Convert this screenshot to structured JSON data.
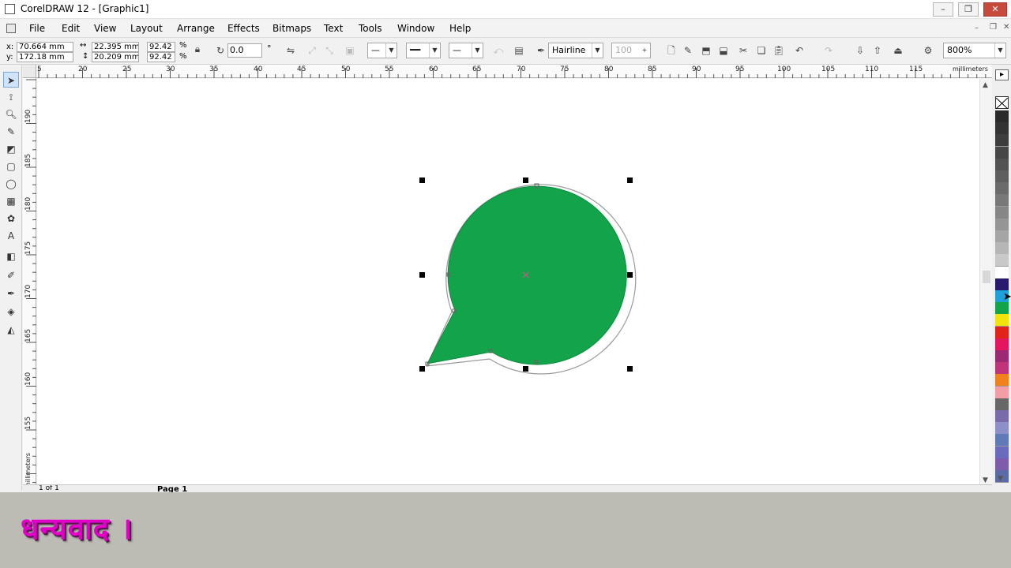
{
  "window": {
    "title": "CorelDRAW 12 - [Graphic1]",
    "controls": [
      "minimize",
      "restore",
      "close"
    ]
  },
  "menu": [
    "File",
    "Edit",
    "View",
    "Layout",
    "Arrange",
    "Effects",
    "Bitmaps",
    "Text",
    "Tools",
    "Window",
    "Help"
  ],
  "propbar": {
    "x_label": "x:",
    "x_value": "70.664 mm",
    "y_label": "y:",
    "y_value": "172.18 mm",
    "width_value": "22.395 mm",
    "height_value": "20.209 mm",
    "scale_x": "92.42",
    "scale_y": "92.42",
    "percent": "%",
    "rotation": "0.0",
    "degree": "°",
    "outline_width": "Hairline",
    "opacity_value": "100",
    "zoom": "800%"
  },
  "rulers": {
    "h_ticks": [
      "5",
      "20",
      "25",
      "30",
      "35",
      "40",
      "45",
      "50",
      "55",
      "60",
      "65",
      "70",
      "75",
      "80",
      "85",
      "90",
      "95",
      "100",
      "105",
      "110",
      "115"
    ],
    "h_unit": "millimeters",
    "v_ticks": [
      "190",
      "185",
      "180",
      "175",
      "170",
      "165",
      "160",
      "155"
    ],
    "v_unit": "millimeters"
  },
  "palette_colors": [
    "#2a2a2a",
    "#333333",
    "#3d3d3d",
    "#474747",
    "#525252",
    "#5e5e5e",
    "#6b6b6b",
    "#787878",
    "#868686",
    "#959595",
    "#a5a5a5",
    "#b6b6b6",
    "#c8c8c8",
    "#ffffff",
    "#2a1a6e",
    "#1ea0d9",
    "#13a34b",
    "#f1e40c",
    "#e2231a",
    "#e4165d",
    "#9c2a73",
    "#c0357a",
    "#f0821e",
    "#f39ea6",
    "#676767",
    "#7a6aa9",
    "#8d8fc8",
    "#5f7bb7",
    "#6a6abf",
    "#7c5cab",
    "#5b6ba8"
  ],
  "shape": {
    "fill": "#13a34b",
    "outline": "#999999"
  },
  "pagebar": {
    "nav": "1 of 1",
    "page": "Page 1"
  },
  "banner": {
    "text": "धन्यवाद ।",
    "color": "#e000c8",
    "background": "#bcbcb4"
  }
}
